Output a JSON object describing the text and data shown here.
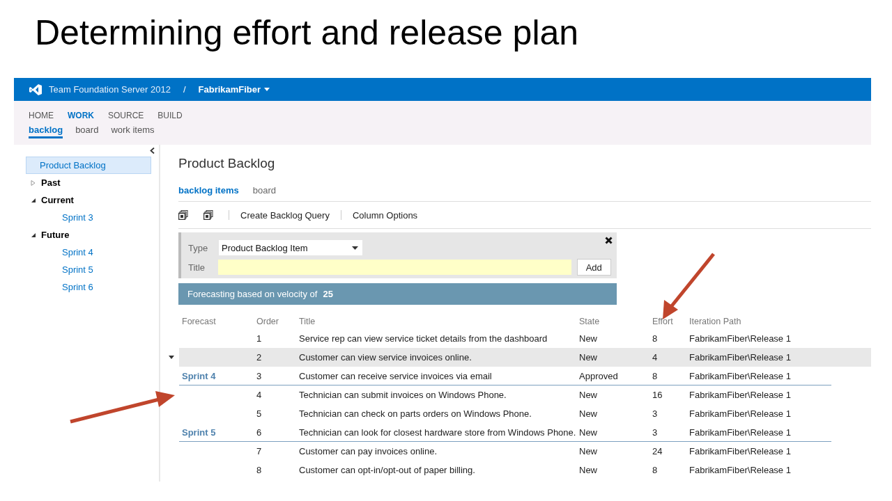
{
  "slide_title": "Determining effort and release plan",
  "header": {
    "product": "Team Foundation Server 2012",
    "separator": "/",
    "project": "FabrikamFiber"
  },
  "nav": [
    {
      "label": "HOME",
      "selected": false
    },
    {
      "label": "WORK",
      "selected": true
    },
    {
      "label": "SOURCE",
      "selected": false
    },
    {
      "label": "BUILD",
      "selected": false
    }
  ],
  "subnav": [
    {
      "label": "backlog",
      "selected": true
    },
    {
      "label": "board",
      "selected": false
    },
    {
      "label": "work items",
      "selected": false
    }
  ],
  "sidebar": {
    "items": [
      {
        "label": "Product Backlog",
        "kind": "link",
        "selected": true
      },
      {
        "label": "Past",
        "kind": "group",
        "selected": false,
        "expanded": false
      },
      {
        "label": "Current",
        "kind": "group",
        "selected": false,
        "expanded": true,
        "children": [
          {
            "label": "Sprint 3",
            "kind": "link",
            "selected": false
          }
        ]
      },
      {
        "label": "Future",
        "kind": "group",
        "selected": false,
        "expanded": true,
        "children": [
          {
            "label": "Sprint 4",
            "kind": "link",
            "selected": false
          },
          {
            "label": "Sprint 5",
            "kind": "link",
            "selected": false
          },
          {
            "label": "Sprint 6",
            "kind": "link",
            "selected": false
          }
        ]
      }
    ]
  },
  "main": {
    "title": "Product Backlog",
    "tabs": [
      {
        "label": "backlog items",
        "selected": true
      },
      {
        "label": "board",
        "selected": false
      }
    ],
    "toolbar": [
      "Create Backlog Query",
      "Column Options"
    ],
    "quick_add": {
      "type_label": "Type",
      "type_value": "Product Backlog Item",
      "title_label": "Title",
      "add_button": "Add"
    },
    "forecast_bar": {
      "text": "Forecasting based on velocity of",
      "velocity": "25"
    },
    "table": {
      "columns": [
        "Forecast",
        "Order",
        "Title",
        "State",
        "Effort",
        "Iteration Path"
      ],
      "rows": [
        {
          "order": "1",
          "title": "Service rep can view service ticket details from the dashboard",
          "state": "New",
          "effort": "8",
          "iteration": "FabrikamFiber\\Release 1",
          "selected": false
        },
        {
          "order": "2",
          "title": "Customer can view service invoices online.",
          "state": "New",
          "effort": "4",
          "iteration": "FabrikamFiber\\Release 1",
          "selected": true
        },
        {
          "forecast": "Sprint 4",
          "order": "3",
          "title": "Customer can receive service invoices via email",
          "state": "Approved",
          "effort": "8",
          "iteration": "FabrikamFiber\\Release 1",
          "selected": false
        },
        {
          "order": "4",
          "title": "Technician can submit invoices on Windows Phone.",
          "state": "New",
          "effort": "16",
          "iteration": "FabrikamFiber\\Release 1",
          "selected": false
        },
        {
          "order": "5",
          "title": "Technician can check on parts orders on Windows Phone.",
          "state": "New",
          "effort": "3",
          "iteration": "FabrikamFiber\\Release 1",
          "selected": false
        },
        {
          "forecast": "Sprint 5",
          "order": "6",
          "title": "Technician can look for closest hardware store from Windows Phone.",
          "state": "New",
          "effort": "3",
          "iteration": "FabrikamFiber\\Release 1",
          "selected": false
        },
        {
          "order": "7",
          "title": "Customer can pay invoices online.",
          "state": "New",
          "effort": "24",
          "iteration": "FabrikamFiber\\Release 1",
          "selected": false
        },
        {
          "order": "8",
          "title": "Customer can opt-in/opt-out of paper billing.",
          "state": "New",
          "effort": "8",
          "iteration": "FabrikamFiber\\Release 1",
          "selected": false
        }
      ]
    }
  }
}
